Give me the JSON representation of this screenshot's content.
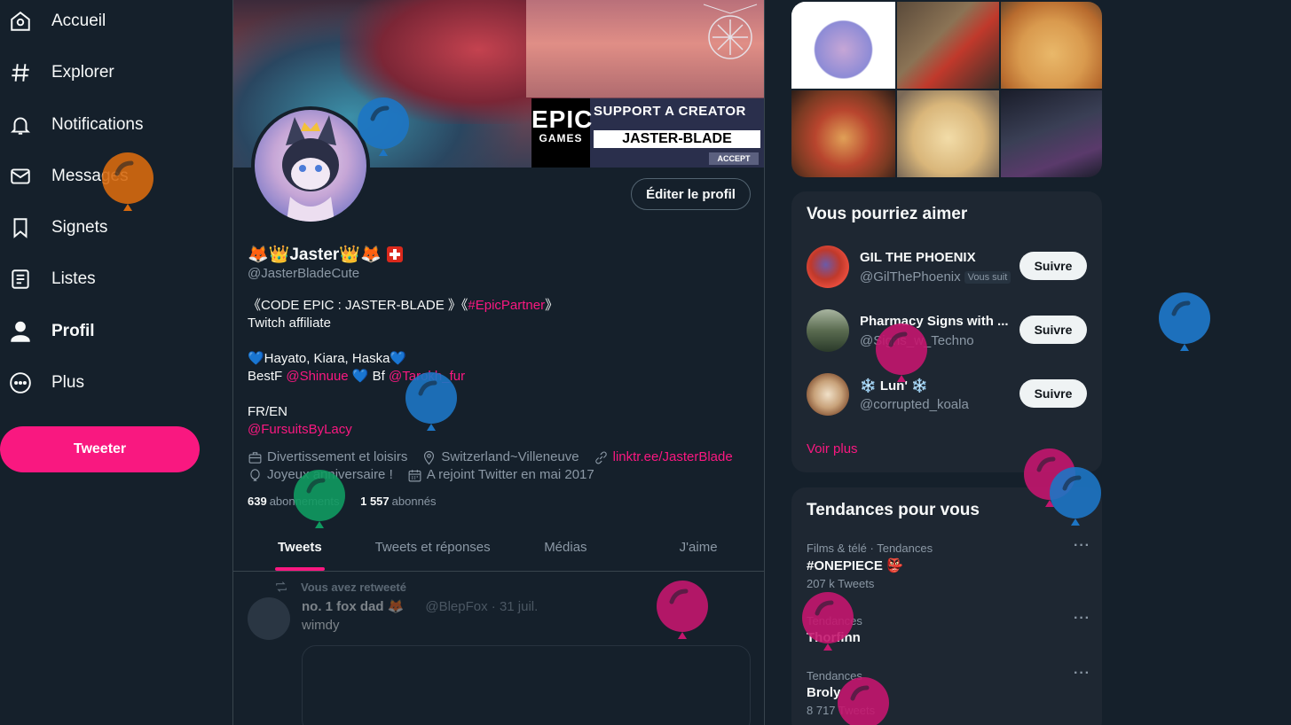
{
  "nav": {
    "items": [
      {
        "label": "Accueil",
        "icon": "home-icon"
      },
      {
        "label": "Explorer",
        "icon": "hashtag-icon"
      },
      {
        "label": "Notifications",
        "icon": "bell-icon"
      },
      {
        "label": "Messages",
        "icon": "envelope-icon"
      },
      {
        "label": "Signets",
        "icon": "bookmark-icon"
      },
      {
        "label": "Listes",
        "icon": "list-icon"
      },
      {
        "label": "Profil",
        "icon": "person-icon"
      },
      {
        "label": "Plus",
        "icon": "more-circle-icon"
      }
    ],
    "tweet_button": "Tweeter"
  },
  "banner": {
    "epic_logo_top": "EPIC",
    "epic_logo_bottom": "GAMES",
    "support_text": "SUPPORT A CREATOR",
    "creator_code": "JASTER-BLADE",
    "accept": "ACCEPT"
  },
  "profile": {
    "edit_button": "Éditer le profil",
    "display_name": "🦊👑Jaster👑🦊",
    "handle": "@JasterBladeCute",
    "bio": {
      "line1_text": "《CODE EPIC : JASTER-BLADE 》《",
      "line1_link": "#EpicPartner",
      "line1_end": "》",
      "line2": "Twitch affiliate",
      "line3": "💙Hayato, Kiara, Haska💙",
      "line4_a": "BestF ",
      "line4_link1": "@Shinuue",
      "line4_b": " 💙 Bf ",
      "line4_link2": "@Tarokh_fur",
      "line5": "FR/EN",
      "line6_link": "@FursuitsByLacy"
    },
    "meta": {
      "category": "Divertissement et loisirs",
      "location": "Switzerland~Villeneuve",
      "website": "linktr.ee/JasterBlade",
      "birthday": "Joyeux anniversaire !",
      "joined": "A rejoint Twitter en mai 2017"
    },
    "following_count": "639",
    "following_label": "abonnements",
    "followers_count": "1 557",
    "followers_label": "abonnés"
  },
  "tabs": [
    "Tweets",
    "Tweets et réponses",
    "Médias",
    "J'aime"
  ],
  "timeline": {
    "retweet_label": "Vous avez retweeté",
    "tweet": {
      "name": "no. 1 fox dad 🦊",
      "handle_time": "@BlepFox · 31 juil.",
      "text": "wimdy"
    }
  },
  "suggestions": {
    "title": "Vous pourriez aimer",
    "items": [
      {
        "name": "GIL THE PHOENIX",
        "handle": "@GilThePhoenix",
        "badge": "Vous suit",
        "button": "Suivre"
      },
      {
        "name": "Pharmacy Signs with ...",
        "handle": "@Signs_w_Techno",
        "badge": "",
        "button": "Suivre"
      },
      {
        "name": "❄️ Lun' ❄️",
        "handle": "@corrupted_koala",
        "badge": "",
        "button": "Suivre"
      }
    ],
    "show_more": "Voir plus"
  },
  "trends": {
    "title": "Tendances pour vous",
    "items": [
      {
        "context": "Films & télé · Tendances",
        "topic": "#ONEPIECE 👺",
        "count": "207 k Tweets"
      },
      {
        "context": "Tendances",
        "topic": "Thorfinn",
        "count": ""
      },
      {
        "context": "Tendances",
        "topic": "Broly",
        "count": "8 717 Tweets"
      }
    ],
    "more_symbol": "···"
  },
  "colors": {
    "background": "#15202b",
    "accent": "#f91880",
    "panel": "#1e2732",
    "muted_text": "#8b98a5"
  }
}
